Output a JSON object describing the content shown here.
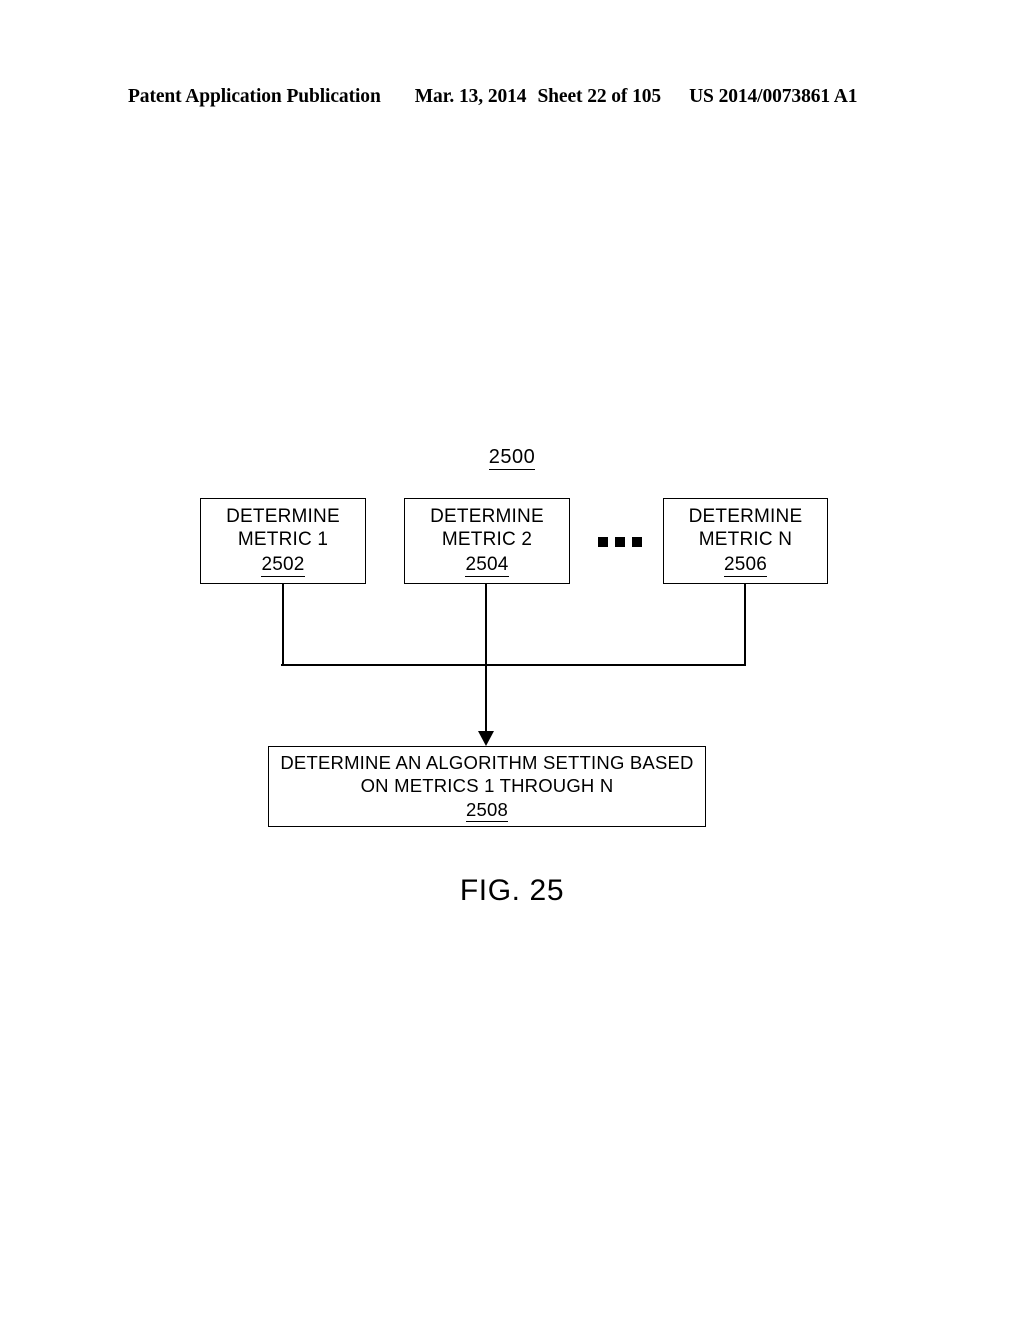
{
  "header": {
    "publication": "Patent Application Publication",
    "date": "Mar. 13, 2014",
    "sheet": "Sheet 22 of 105",
    "patent_number": "US 2014/0073861 A1"
  },
  "figure": {
    "caption": "FIG. 25",
    "diagram_reference": "2500",
    "ellipsis_icon": "horizontal-ellipsis-icon",
    "arrow_icon": "down-arrow-icon",
    "boxes": [
      {
        "id": "2502",
        "line1": "DETERMINE",
        "line2": "METRIC 1",
        "refnum": "2502"
      },
      {
        "id": "2504",
        "line1": "DETERMINE",
        "line2": "METRIC 2",
        "refnum": "2504"
      },
      {
        "id": "2506",
        "line1": "DETERMINE",
        "line2": "METRIC N",
        "refnum": "2506"
      }
    ],
    "result_box": {
      "id": "2508",
      "line1": "DETERMINE AN ALGORITHM SETTING BASED",
      "line2": "ON METRICS 1 THROUGH N",
      "refnum": "2508"
    }
  }
}
